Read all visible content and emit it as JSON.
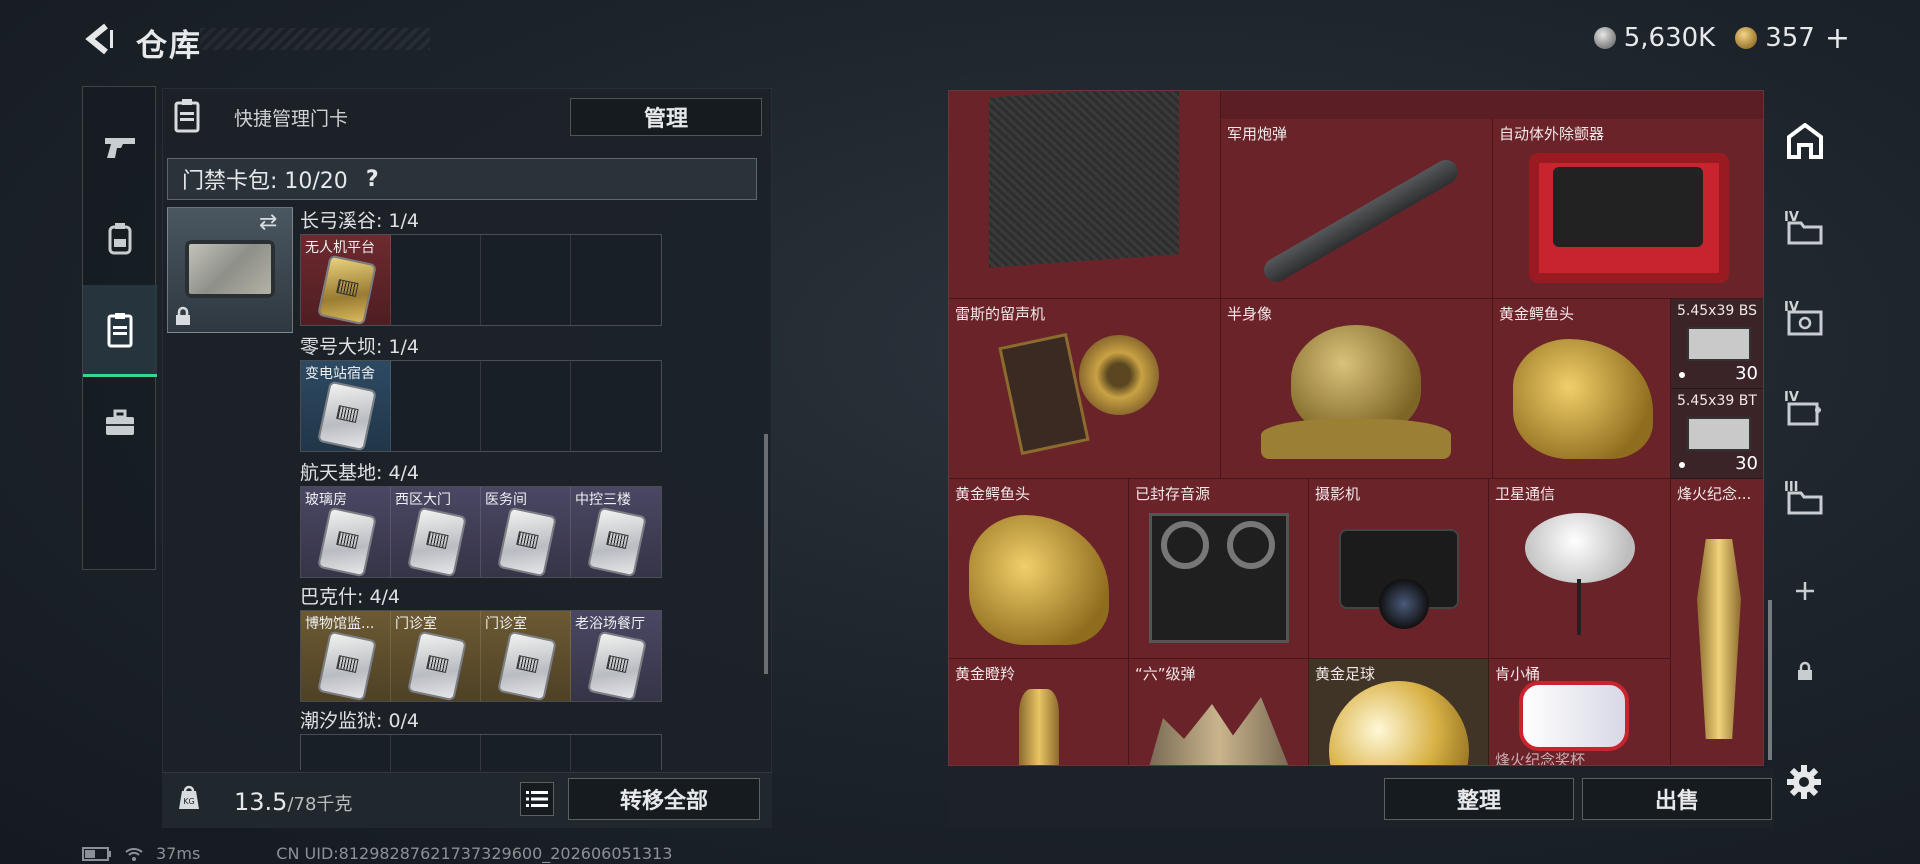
{
  "header": {
    "title": "仓库",
    "currencies": [
      {
        "icon": "silver-coin-icon",
        "value": "5,630K"
      },
      {
        "icon": "gold-coin-icon",
        "value": "357"
      }
    ],
    "add_label": "+"
  },
  "left_panel": {
    "quick_manage_label": "快捷管理门卡",
    "manage_button": "管理",
    "card_wallet_label": "门禁卡包: 10/20",
    "help_label": "?",
    "groups": [
      {
        "label": "长弓溪谷: 1/4",
        "slots": [
          {
            "name": "无人机平台",
            "style": "red"
          },
          {},
          {},
          {}
        ]
      },
      {
        "label": "零号大坝: 1/4",
        "slots": [
          {
            "name": "变电站宿舍",
            "style": "blue"
          },
          {},
          {},
          {}
        ]
      },
      {
        "label": "航天基地: 4/4",
        "slots": [
          {
            "name": "玻璃房",
            "style": "purple"
          },
          {
            "name": "西区大门",
            "style": "purple"
          },
          {
            "name": "医务间",
            "style": "purple"
          },
          {
            "name": "中控三楼",
            "style": "purple"
          }
        ]
      },
      {
        "label": "巴克什: 4/4",
        "slots": [
          {
            "name": "博物馆监...",
            "style": "gold"
          },
          {
            "name": "门诊室",
            "style": "gold"
          },
          {
            "name": "门诊室",
            "style": "gold"
          },
          {
            "name": "老浴场餐厅",
            "style": "purple"
          }
        ]
      },
      {
        "label": "潮汐监狱: 0/4",
        "slots": []
      }
    ],
    "weight_current": "13.5",
    "weight_max": "/78千克",
    "transfer_all_button": "转移全部"
  },
  "inventory": {
    "items": [
      {
        "label": "军用炮弹"
      },
      {
        "label": "自动体外除颤器"
      },
      {
        "label": "雷斯的留声机"
      },
      {
        "label": "半身像"
      },
      {
        "label": "黄金鳄鱼头"
      },
      {
        "label": "5.45x39 BS",
        "count": "30"
      },
      {
        "label": "5.45x39 BT",
        "count": "30"
      },
      {
        "label": "黄金鳄鱼头"
      },
      {
        "label": "已封存音源"
      },
      {
        "label": "摄影机"
      },
      {
        "label": "卫星通信"
      },
      {
        "label": "烽火纪念..."
      },
      {
        "label": "黄金瞪羚"
      },
      {
        "label": "“六”级弹"
      },
      {
        "label": "黄金足球"
      },
      {
        "label": "肯小桶"
      },
      {
        "label": "烽火纪念奖杯"
      }
    ],
    "organize_button": "整理",
    "sell_button": "出售"
  },
  "right_tabs": [
    {
      "icon": "home-icon"
    },
    {
      "icon": "folder-icon",
      "level": "IV"
    },
    {
      "icon": "safe-icon",
      "level": "IV"
    },
    {
      "icon": "medical-case-icon",
      "level": "IV"
    },
    {
      "icon": "folder-icon",
      "level": "III"
    },
    {
      "icon": "plus-icon"
    },
    {
      "icon": "lock-icon"
    }
  ],
  "status_bar": {
    "ping": "37ms",
    "uid": "CN UID:81298287621737329600_202606051313"
  },
  "colors": {
    "accent": "#37d68a",
    "inventory_bg": "#6b232a"
  }
}
